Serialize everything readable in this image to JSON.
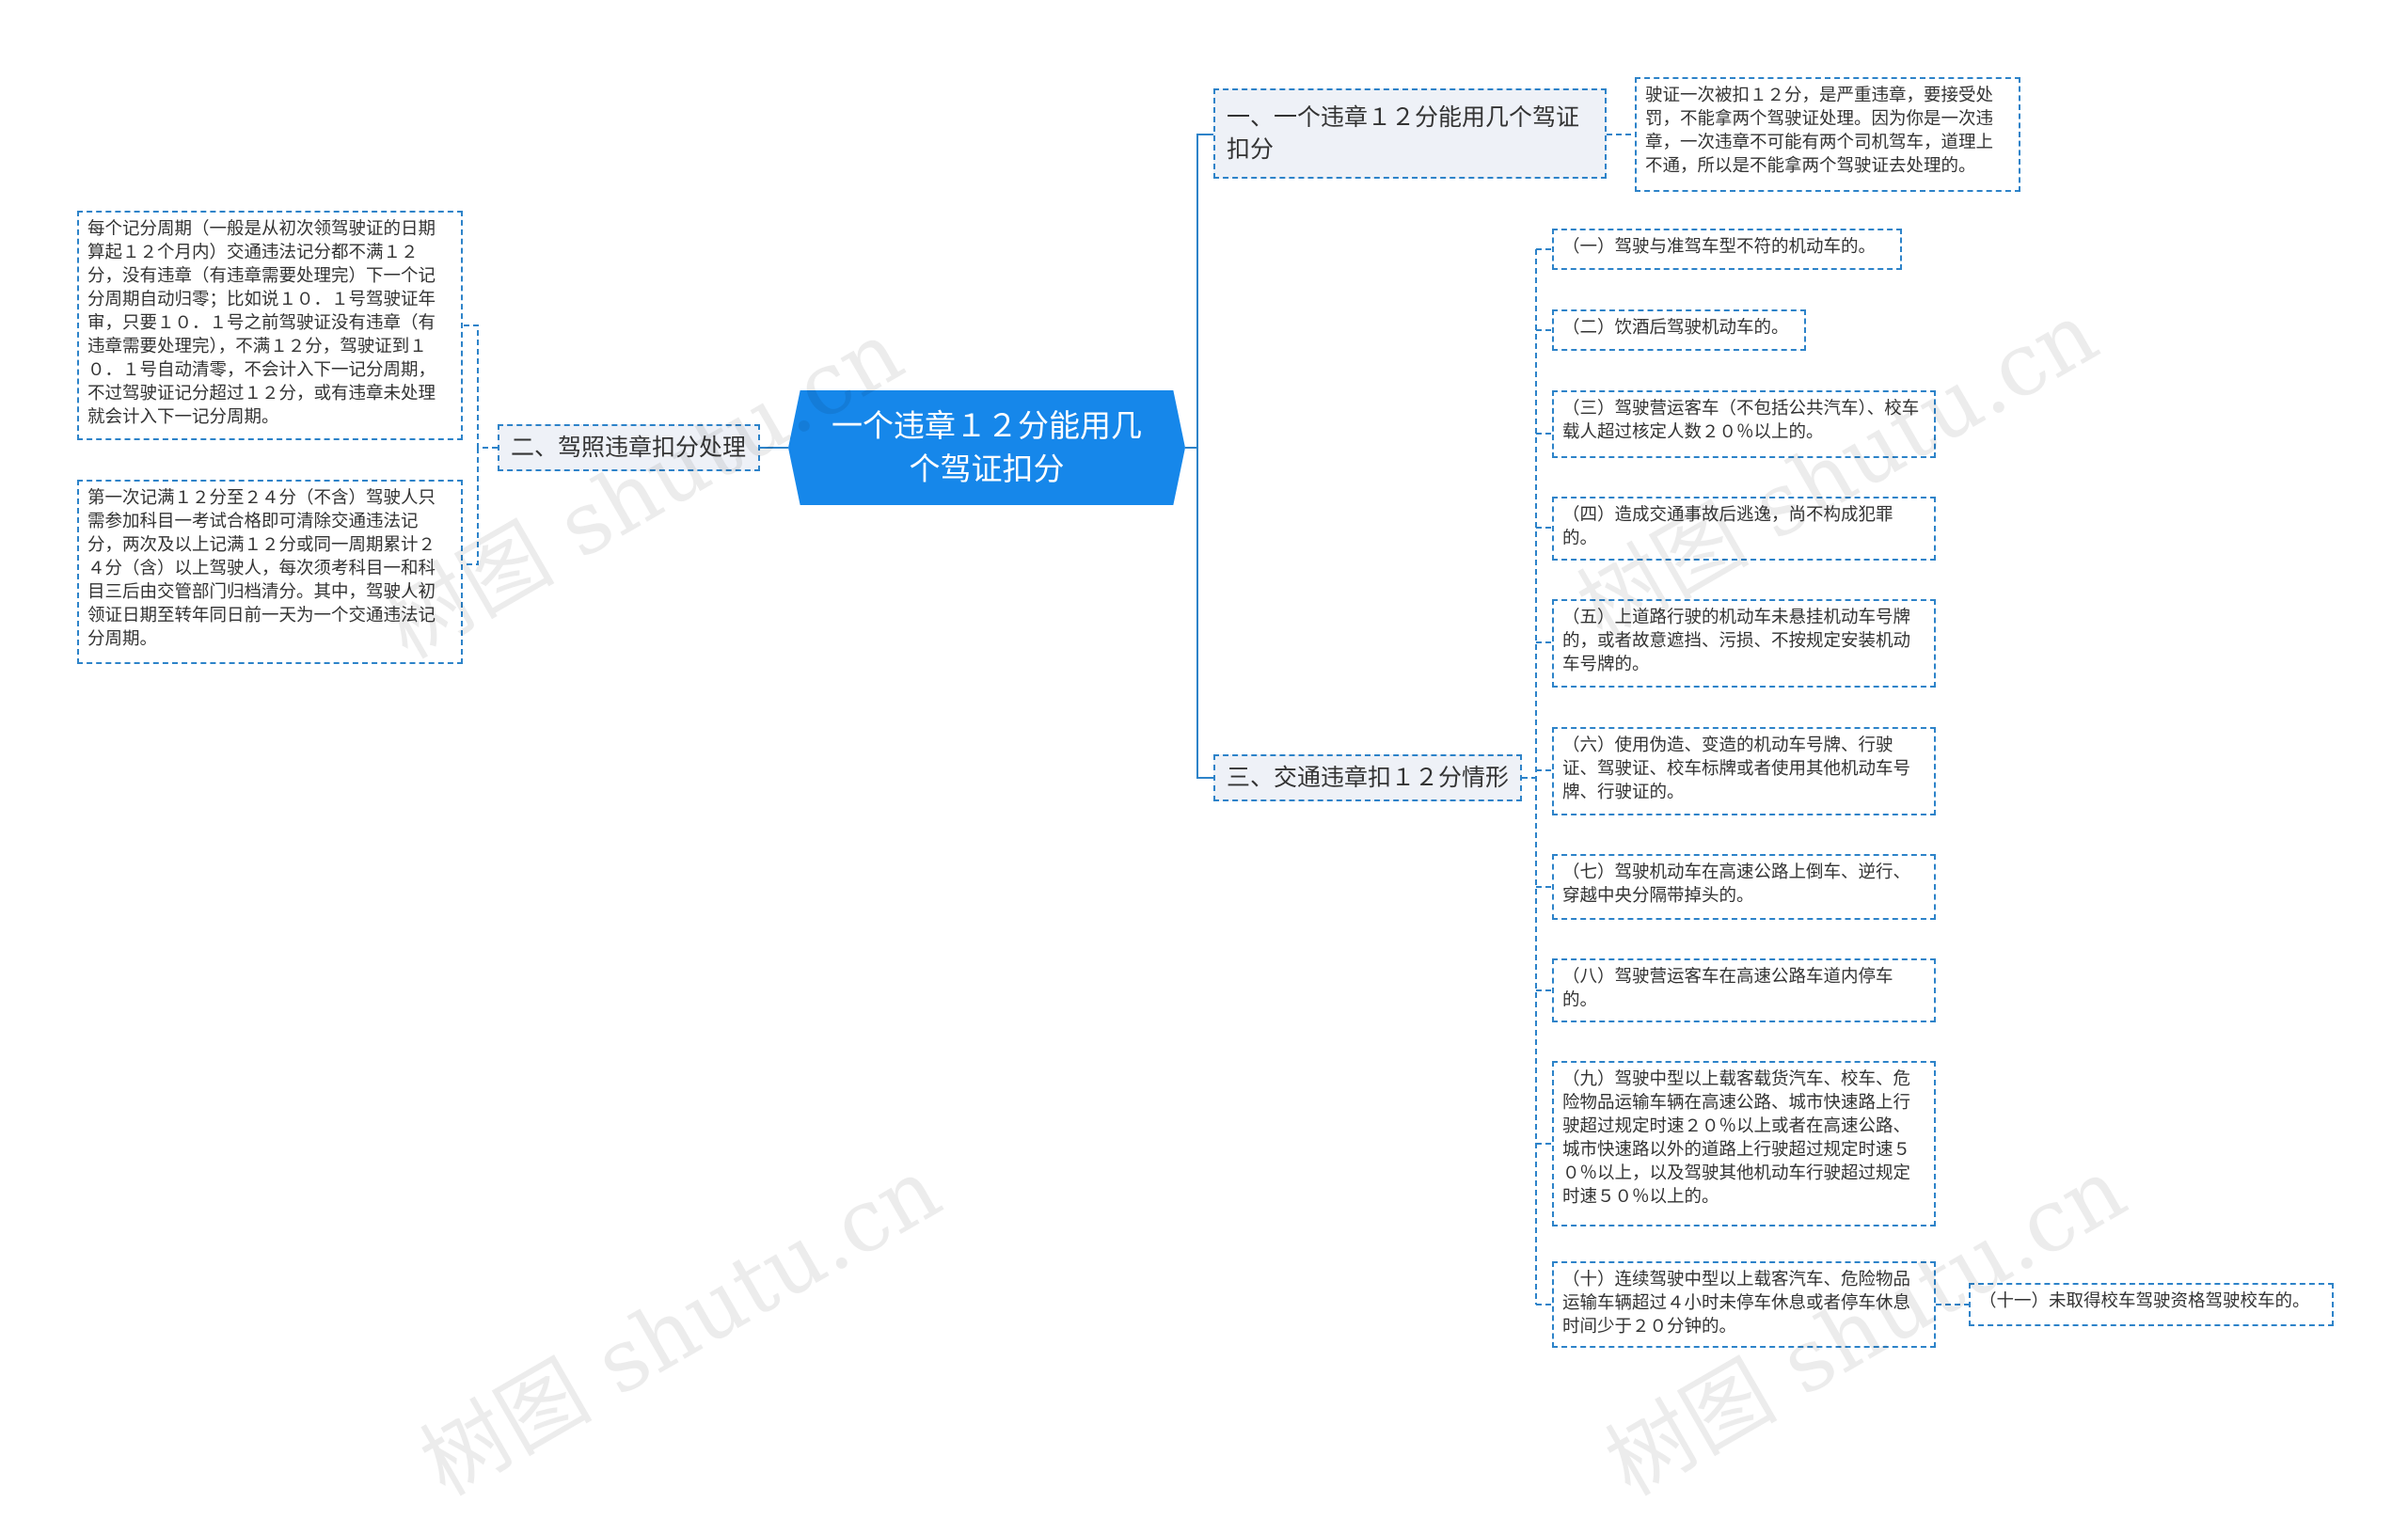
{
  "root": {
    "label": "一个违章１２分能用几个驾证扣分"
  },
  "branches": [
    {
      "label": "一、一个违章１２分能用几个驾证扣分",
      "children": [
        "驶证一次被扣１２分，是严重违章，要接受处罚，不能拿两个驾驶证处理。因为你是一次违章，一次违章不可能有两个司机驾车，道理上不通，所以是不能拿两个驾驶证去处理的。"
      ]
    },
    {
      "label": "二、驾照违章扣分处理",
      "children": [
        "每个记分周期（一般是从初次领驾驶证的日期算起１２个月内）交通违法记分都不满１２分，没有违章（有违章需要处理完）下一个记分周期自动归零；比如说１０．１号驾驶证年审，只要１０．１号之前驾驶证没有违章（有违章需要处理完），不满１２分，驾驶证到１０．１号自动清零，不会计入下一记分周期，不过驾驶证记分超过１２分，或有违章未处理就会计入下一记分周期。",
        "第一次记满１２分至２４分（不含）驾驶人只需参加科目一考试合格即可清除交通违法记分，两次及以上记满１２分或同一周期累计２４分（含）以上驾驶人，每次须考科目一和科目三后由交管部门归档清分。其中，驾驶人初领证日期至转年同日前一天为一个交通违法记分周期。"
      ]
    },
    {
      "label": "三、交通违章扣１２分情形",
      "children": [
        "（一）驾驶与准驾车型不符的机动车的。",
        "（二）饮酒后驾驶机动车的。",
        "（三）驾驶营运客车（不包括公共汽车）、校车载人超过核定人数２０％以上的。",
        "（四）造成交通事故后逃逸，尚不构成犯罪的。",
        "（五）上道路行驶的机动车未悬挂机动车号牌的，或者故意遮挡、污损、不按规定安装机动车号牌的。",
        "（六）使用伪造、变造的机动车号牌、行驶证、驾驶证、校车标牌或者使用其他机动车号牌、行驶证的。",
        "（七）驾驶机动车在高速公路上倒车、逆行、穿越中央分隔带掉头的。",
        "（八）驾驶营运客车在高速公路车道内停车的。",
        "（九）驾驶中型以上载客载货汽车、校车、危险物品运输车辆在高速公路、城市快速路上行驶超过规定时速２０％以上或者在高速公路、城市快速路以外的道路上行驶超过规定时速５０％以上，以及驾驶其他机动车行驶超过规定时速５０％以上的。",
        "（十）连续驾驶中型以上载客汽车、危险物品运输车辆超过４小时未停车休息或者停车休息时间少于２０分钟的。"
      ],
      "extra": "（十一）未取得校车驾驶资格驾驶校车的。"
    }
  ],
  "watermark": "树图 shutu.cn",
  "colors": {
    "root": "#1687ea",
    "line": "#2d83c9",
    "branch_bg": "#eef1f7"
  }
}
